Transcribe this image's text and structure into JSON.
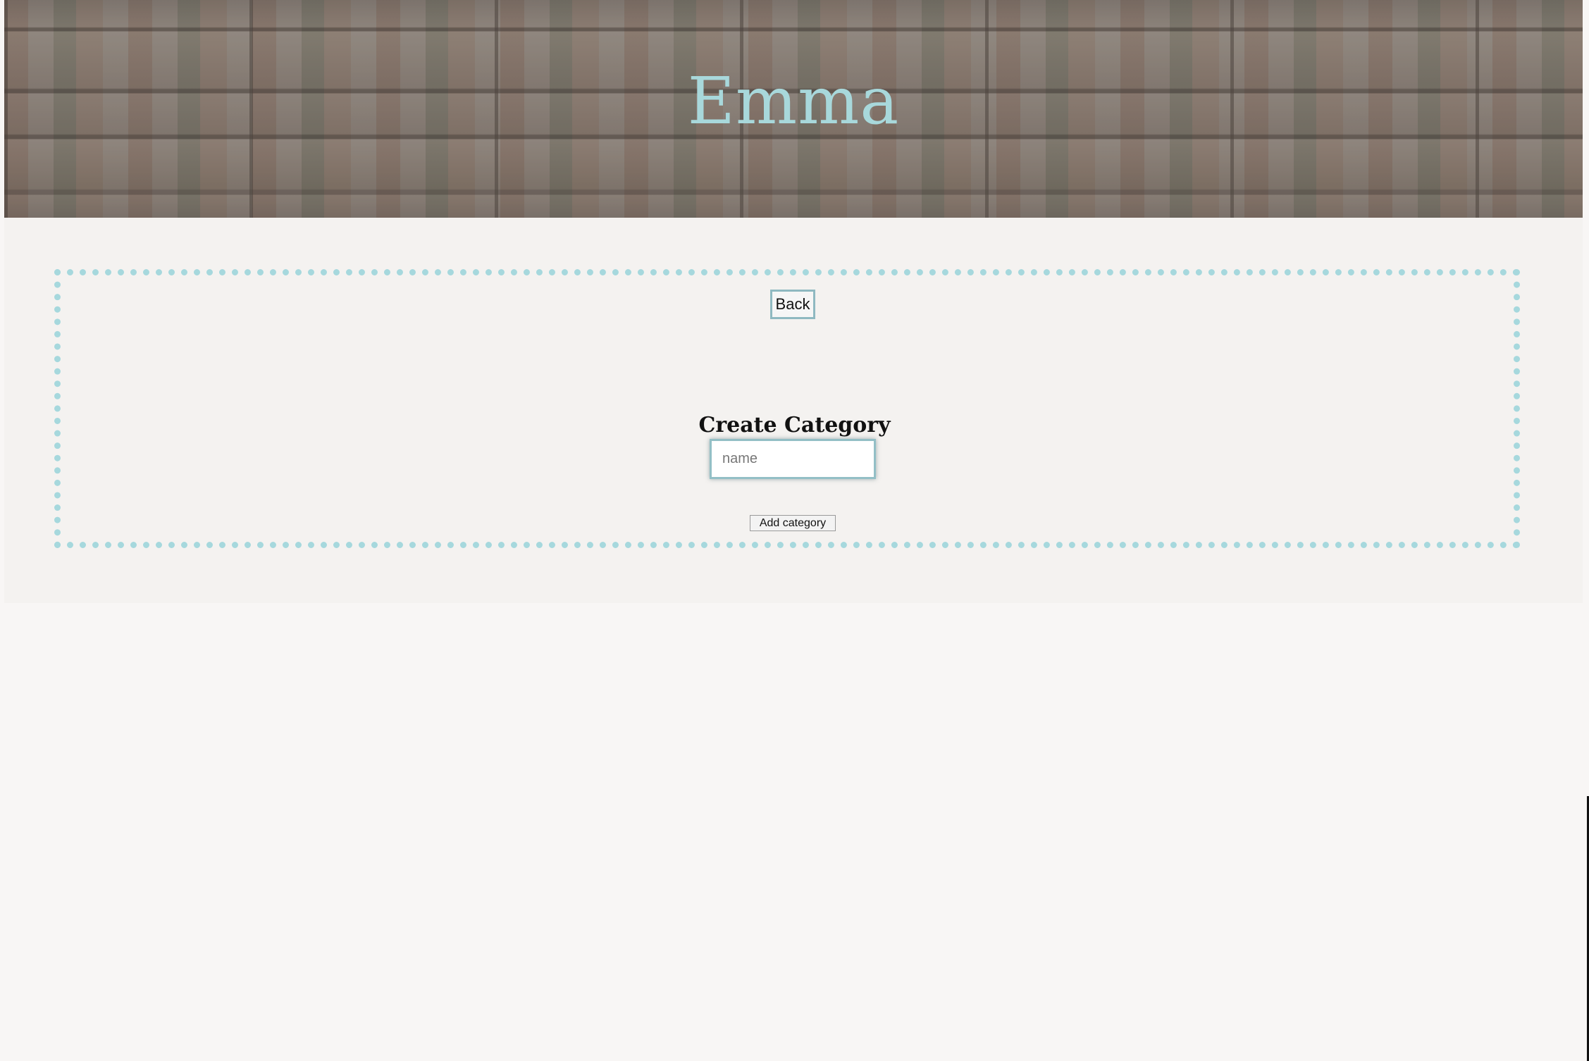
{
  "header": {
    "title": "Emma"
  },
  "navigation": {
    "back_label": "Back"
  },
  "form": {
    "title": "Create Category",
    "name_placeholder": "name",
    "name_value": "",
    "submit_label": "Add category"
  },
  "colors": {
    "accent": "#a6d8dd",
    "title": "#a8d8db",
    "input_border": "#93bfc6",
    "page_background": "#f4f2f0"
  }
}
